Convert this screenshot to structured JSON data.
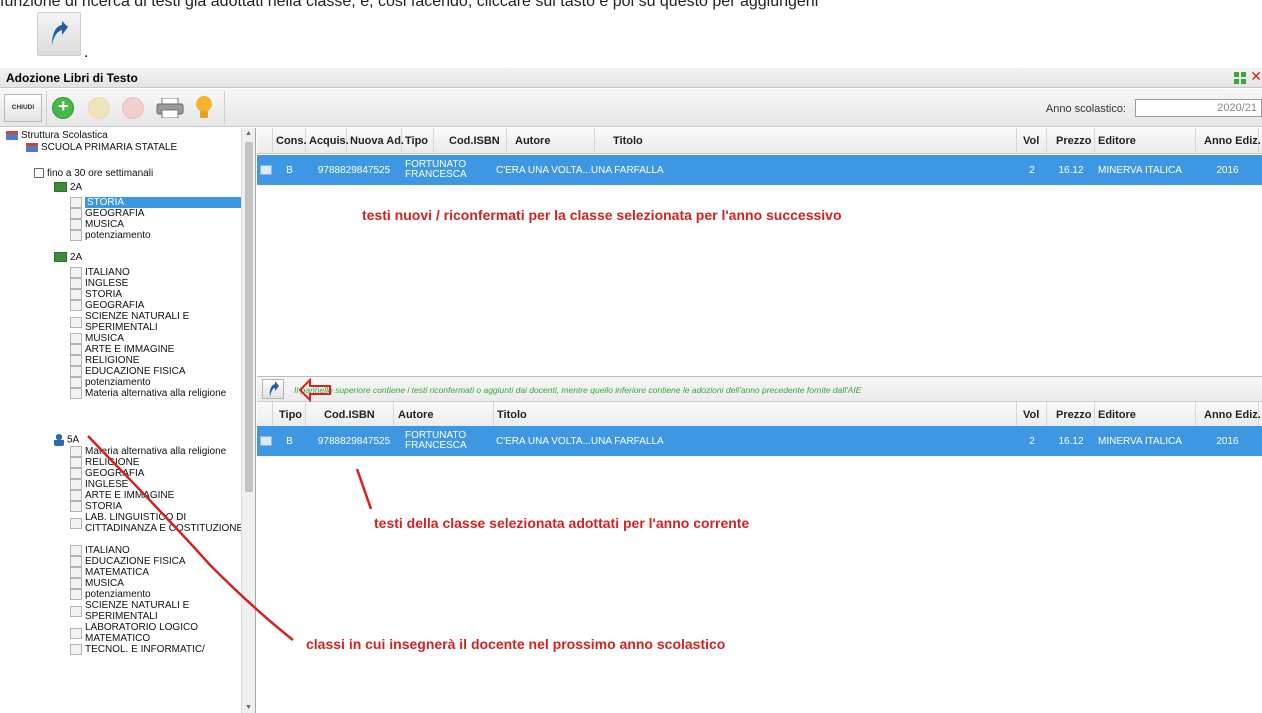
{
  "doc": {
    "top_text": "funzione di ricerca di testi gia adottati nella classe, e, cosi facendo, cliccare sul tasto e poi su questo per aggiungerli",
    "trailing_dot": "."
  },
  "window": {
    "title": "Adozione Libri di Testo",
    "close_glyph": "✕"
  },
  "toolbar": {
    "close_label": "CHIUDI",
    "year_label": "Anno scolastico:",
    "year_value": "2020/21"
  },
  "tree": {
    "root": "Struttura Scolastica",
    "school": "SCUOLA PRIMARIA STATALE",
    "hours": "fino a 30 ore settimanali",
    "class_2a_first": "2A",
    "class_2a_first_subjects": [
      "STORIA",
      "GEOGRAFIA",
      "MUSICA",
      "potenziamento"
    ],
    "class_2a_second": "2A",
    "class_2a_second_subjects": [
      "ITALIANO",
      "INGLESE",
      "STORIA",
      "GEOGRAFIA",
      "SCIENZE NATURALI E SPERIMENTALI",
      "MUSICA",
      "ARTE E IMMAGINE",
      "RELIGIONE",
      "EDUCAZIONE FISICA",
      "potenziamento",
      "Materia alternativa alla religione"
    ],
    "class_5a": "5A",
    "class_5a_subjects": [
      "Materia alternativa alla religione",
      "RELIGIONE",
      "GEOGRAFIA",
      "INGLESE",
      "ARTE E IMMAGINE",
      "STORIA",
      "LAB. LINGUISTICO DI CITTADINANZA E COSTITUZIONE",
      "ITALIANO",
      "EDUCAZIONE FISICA",
      "MATEMATICA",
      "MUSICA",
      "potenziamento",
      "SCIENZE NATURALI E SPERIMENTALI",
      "LABORATORIO LOGICO MATEMATICO",
      "TECNOL. E INFORMATIC/"
    ]
  },
  "top_grid": {
    "headers": {
      "cons": "Cons.",
      "acquis": "Acquis.",
      "nuova": "Nuova Ad.",
      "tipo": "Tipo",
      "isbn": "Cod.ISBN",
      "autore": "Autore",
      "titolo": "Titolo",
      "vol": "Vol",
      "prezzo": "Prezzo",
      "editore": "Editore",
      "anno": "Anno Ediz."
    },
    "row": {
      "cons": "B",
      "isbn": "9788829847525",
      "autore": "FORTUNATO FRANCESCA",
      "titolo": "C'ERA UNA VOLTA...UNA FARFALLA",
      "vol": "2",
      "prezzo": "16.12",
      "editore": "MINERVA ITALICA",
      "anno": "2016"
    }
  },
  "info_bar": {
    "text": "Il pannello superiore contiene i testi riconfermati o aggiunti dai docenti, mentre quello inferiore contiene le adozioni dell'anno precedente fornite dall'AIE"
  },
  "bottom_grid": {
    "headers": {
      "tipo": "Tipo",
      "isbn": "Cod.ISBN",
      "autore": "Autore",
      "titolo": "Titolo",
      "vol": "Vol",
      "prezzo": "Prezzo",
      "editore": "Editore",
      "anno": "Anno Ediz."
    },
    "row": {
      "tipo": "B",
      "isbn": "9788829847525",
      "autore": "FORTUNATO FRANCESCA",
      "titolo": "C'ERA UNA VOLTA...UNA FARFALLA",
      "vol": "2",
      "prezzo": "16.12",
      "editore": "MINERVA ITALICA",
      "anno": "2016"
    }
  },
  "annotations": {
    "top_panel": "testi nuovi / riconfermati per la classe selezionata per l'anno successivo",
    "bottom_panel": "testi della classe selezionata adottati per l'anno corrente",
    "tree": "classi in cui insegnerà il docente nel prossimo anno scolastico"
  },
  "colors": {
    "selected_row": "#3d97e3",
    "annotation": "#d42222",
    "info_text": "#3aa43a"
  }
}
